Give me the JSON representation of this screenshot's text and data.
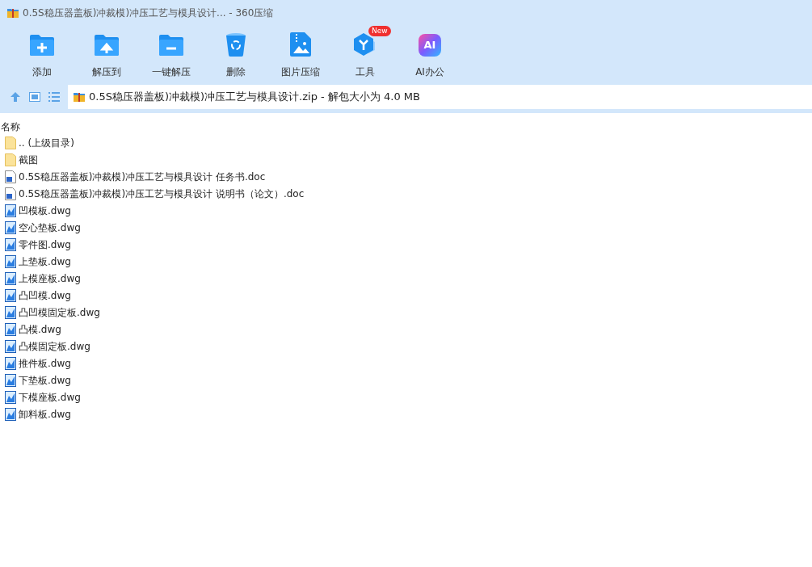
{
  "window": {
    "title": "0.5S稳压器盖板)冲裁模)冲压工艺与模具设计... - 360压缩"
  },
  "toolbar": [
    {
      "kind": "add",
      "label": "添加"
    },
    {
      "kind": "extract-to",
      "label": "解压到"
    },
    {
      "kind": "extract",
      "label": "一键解压"
    },
    {
      "kind": "delete",
      "label": "删除"
    },
    {
      "kind": "image",
      "label": "图片压缩"
    },
    {
      "kind": "tools",
      "label": "工具",
      "badge": "New"
    },
    {
      "kind": "ai",
      "label": "AI办公",
      "icon_text": "AI"
    }
  ],
  "address": {
    "path": "0.5S稳压器盖板)冲裁模)冲压工艺与模具设计.zip - 解包大小为 4.0 MB"
  },
  "list": {
    "columns": [
      "名称"
    ],
    "rows": [
      {
        "kind": "folder",
        "name": ".. (上级目录)"
      },
      {
        "kind": "folder",
        "name": "截图"
      },
      {
        "kind": "doc",
        "name": "0.5S稳压器盖板)冲裁模)冲压工艺与模具设计 任务书.doc"
      },
      {
        "kind": "doc",
        "name": "0.5S稳压器盖板)冲裁模)冲压工艺与模具设计 说明书（论文）.doc"
      },
      {
        "kind": "dwg",
        "name": "凹模板.dwg"
      },
      {
        "kind": "dwg",
        "name": "空心垫板.dwg"
      },
      {
        "kind": "dwg",
        "name": "零件图.dwg"
      },
      {
        "kind": "dwg",
        "name": "上垫板.dwg"
      },
      {
        "kind": "dwg",
        "name": "上模座板.dwg"
      },
      {
        "kind": "dwg",
        "name": "凸凹模.dwg"
      },
      {
        "kind": "dwg",
        "name": "凸凹模固定板.dwg"
      },
      {
        "kind": "dwg",
        "name": "凸模.dwg"
      },
      {
        "kind": "dwg",
        "name": "凸模固定板.dwg"
      },
      {
        "kind": "dwg",
        "name": "推件板.dwg"
      },
      {
        "kind": "dwg",
        "name": "下垫板.dwg"
      },
      {
        "kind": "dwg",
        "name": "下模座板.dwg"
      },
      {
        "kind": "dwg",
        "name": "卸料板.dwg"
      }
    ]
  }
}
